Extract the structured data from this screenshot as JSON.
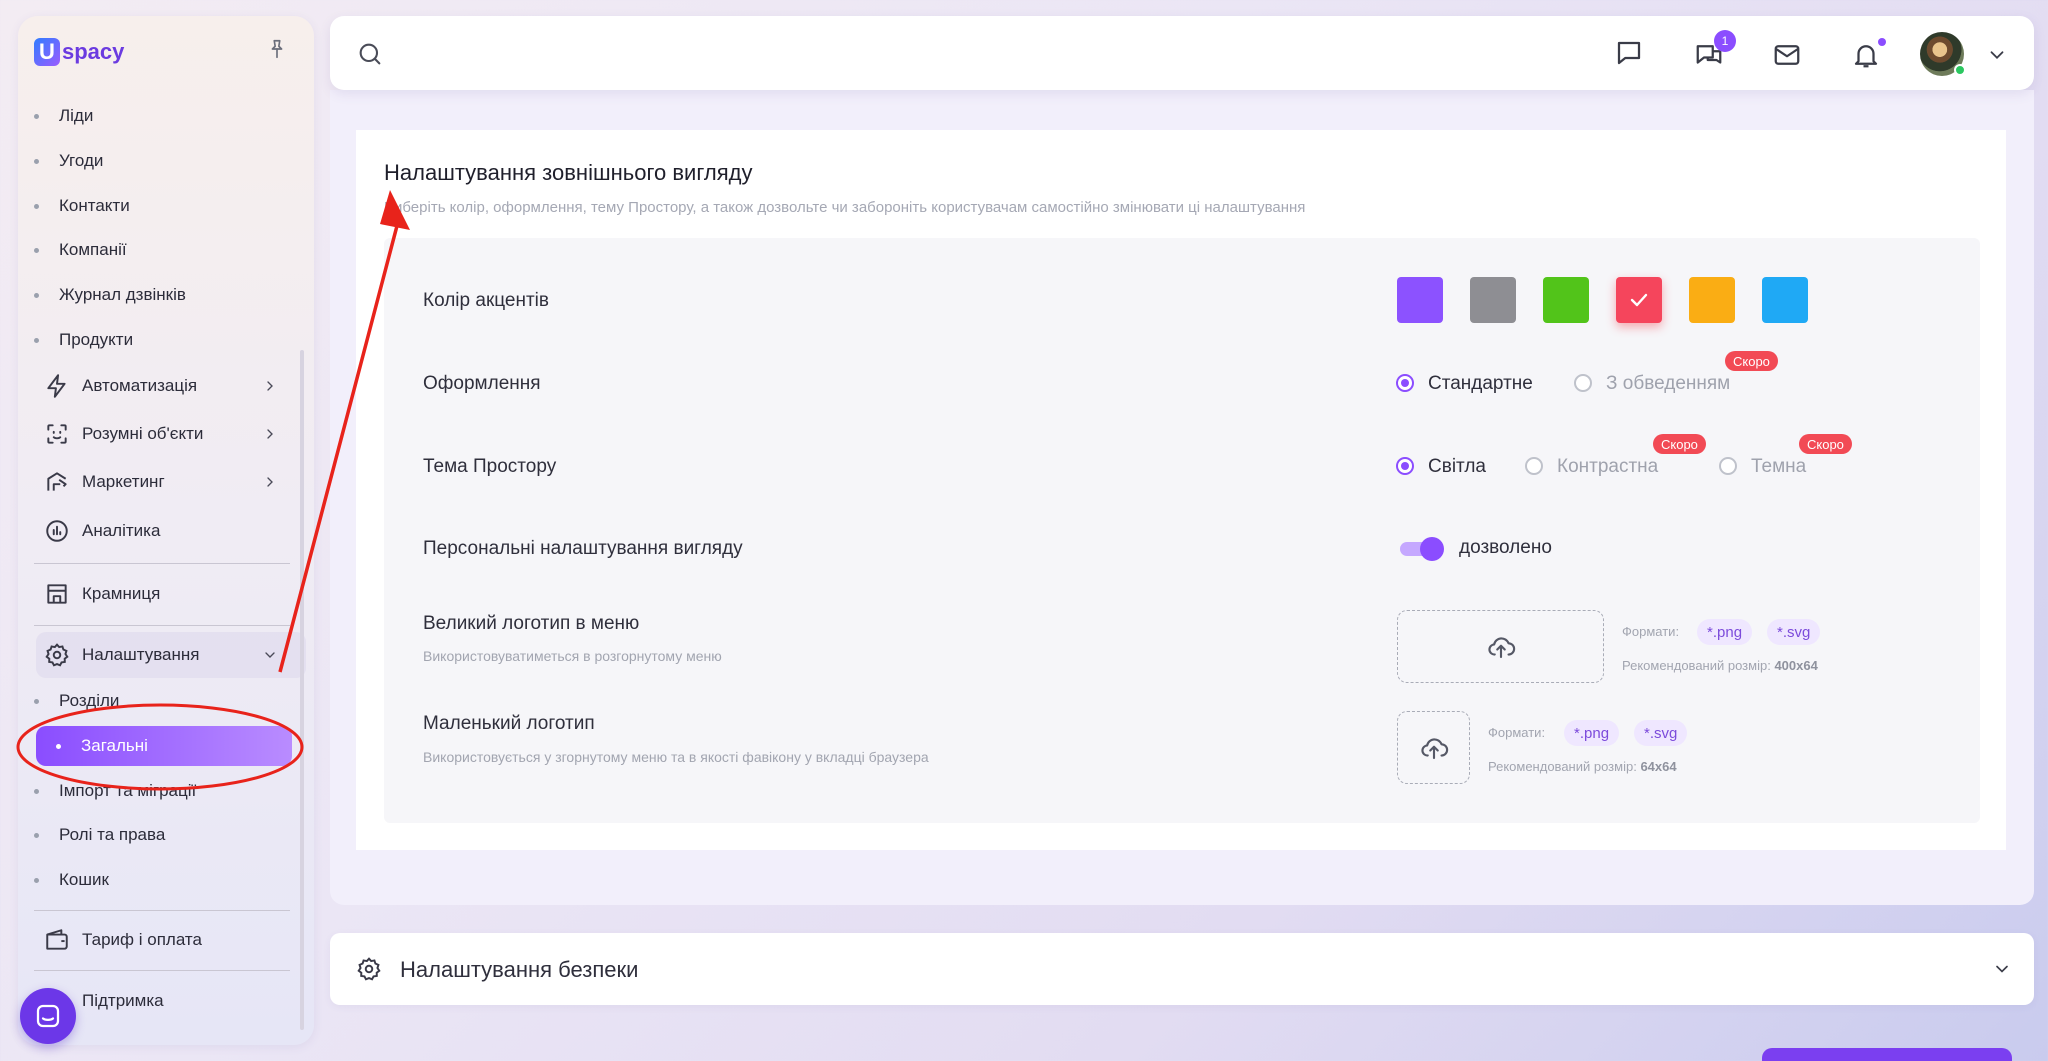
{
  "app": {
    "logo_text": "spacy",
    "logo_letter": "U"
  },
  "sidebar": {
    "crm_items": [
      "Ліди",
      "Угоди",
      "Контакти",
      "Компанії",
      "Журнал дзвінків",
      "Продукти"
    ],
    "main_items": [
      {
        "label": "Автоматизація",
        "icon": "lightning-icon",
        "has_arrow": true
      },
      {
        "label": "Розумні об'єкти",
        "icon": "scan-object-icon",
        "has_arrow": true
      },
      {
        "label": "Маркетинг",
        "icon": "marketing-icon",
        "has_arrow": true
      },
      {
        "label": "Аналітика",
        "icon": "analytics-icon",
        "has_arrow": false
      }
    ],
    "store": "Крамниця",
    "settings": "Налаштування",
    "settings_items": [
      "Розділи",
      "Загальні",
      "Імпорт та міграції",
      "Ролі та права",
      "Кошик"
    ],
    "active_item": "Загальні",
    "tariff": "Тариф і оплата",
    "support": "Підтримка"
  },
  "topbar": {
    "chat_badge": "1",
    "icons": [
      "search-icon",
      "message-icon",
      "chats-icon",
      "mail-icon",
      "bell-icon",
      "avatar",
      "chevron-down-icon"
    ]
  },
  "appearance": {
    "title": "Налаштування зовнішнього вигляду",
    "subtitle": "Виберіть колір, оформлення, тему Простору, а також дозвольте чи забороніть користувачам самостійно змінювати ці налаштування",
    "accent_label": "Колір акцентів",
    "accent_colors": [
      "#8c52ff",
      "#8e8e93",
      "#52c41a",
      "#f5455c",
      "#faad14",
      "#1fa9f5"
    ],
    "accent_selected_index": 3,
    "design_label": "Оформлення",
    "design_options": [
      {
        "label": "Стандартне",
        "checked": true,
        "disabled": false
      },
      {
        "label": "З обведенням",
        "checked": false,
        "disabled": true,
        "badge": "Скоро"
      }
    ],
    "theme_label": "Тема Простору",
    "theme_options": [
      {
        "label": "Світла",
        "checked": true,
        "disabled": false
      },
      {
        "label": "Контрастна",
        "checked": false,
        "disabled": true,
        "badge": "Скоро"
      },
      {
        "label": "Темна",
        "checked": false,
        "disabled": true,
        "badge": "Скоро"
      }
    ],
    "personal_label": "Персональні налаштування вигляду",
    "personal_toggle_on": true,
    "personal_value": "дозволено",
    "big_logo_label": "Великий логотип в меню",
    "big_logo_sub": "Використовуватиметься в розгорнутому меню",
    "small_logo_label": "Маленький логотип",
    "small_logo_sub": "Використовується у згорнутому меню та в якості фавікону у вкладці браузера",
    "formats_label": "Формати:",
    "formats": [
      "*.png",
      "*.svg"
    ],
    "rec_size_label": "Рекомендований розмір:",
    "big_logo_size": "400x64",
    "small_logo_size": "64x64"
  },
  "security": {
    "title": "Налаштування безпеки"
  }
}
